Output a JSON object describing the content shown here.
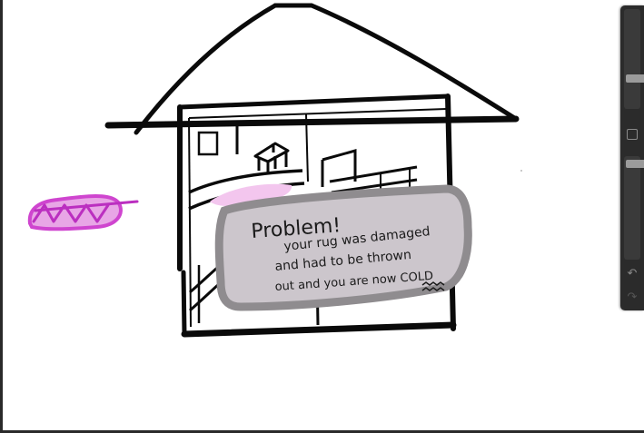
{
  "canvas": {
    "background": "#ffffff"
  },
  "note": {
    "lines": [
      "Problem!",
      "your rug was damaged",
      "and had to be thrown",
      "out and you are now COLD"
    ],
    "fill": "#ccc6cc",
    "border": "#8f8c8f"
  },
  "colors": {
    "ink": "#0a0a0a",
    "magenta": "#d44ad4",
    "pink_smudge": "#f3c6ee"
  },
  "sidebar": {
    "brush_size_level": 0.22,
    "opacity_level": 0.55,
    "icons": [
      "modify-square-icon",
      "undo-icon",
      "redo-icon"
    ]
  }
}
